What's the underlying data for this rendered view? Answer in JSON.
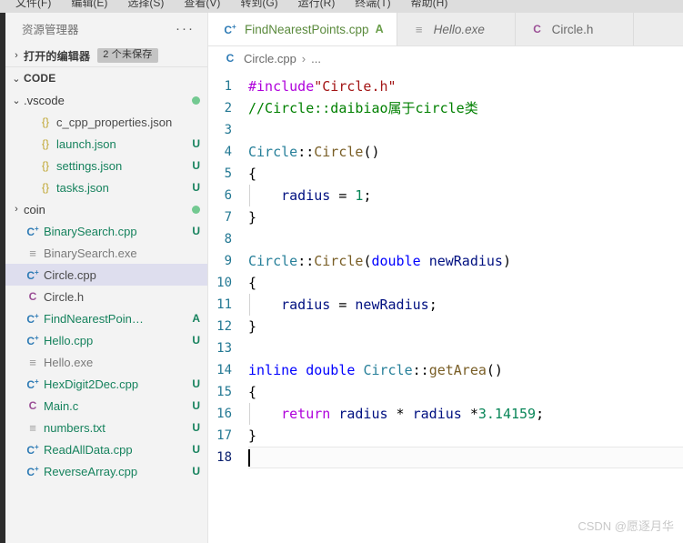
{
  "menubar": {
    "items": [
      {
        "label": "文件(F)"
      },
      {
        "label": "编辑(E)"
      },
      {
        "label": "选择(S)"
      },
      {
        "label": "查看(V)"
      },
      {
        "label": "转到(G)"
      },
      {
        "label": "运行(R)"
      },
      {
        "label": "终端(T)"
      },
      {
        "label": "帮助(H)"
      }
    ]
  },
  "sidebar": {
    "title": "资源管理器",
    "more_label": "···",
    "open_editors": {
      "twisty": "›",
      "label": "打开的编辑器",
      "badge": "2 个未保存"
    },
    "workspace": {
      "twisty": "⌄",
      "label": "CODE"
    },
    "tree": [
      {
        "icon": "chevron-down-icon",
        "icon_glyph": "⌄",
        "icon_class": "",
        "name": ".vscode",
        "kind": "folder",
        "indent": 1,
        "status": "",
        "dot": true
      },
      {
        "icon": "json-file-icon",
        "icon_glyph": "{}",
        "icon_class": "json",
        "name": "c_cpp_properties.json",
        "kind": "file-plain",
        "indent": 2,
        "status": "",
        "dot": false
      },
      {
        "icon": "json-file-icon",
        "icon_glyph": "{}",
        "icon_class": "json",
        "name": "launch.json",
        "kind": "file-mod",
        "indent": 2,
        "status": "U",
        "dot": false
      },
      {
        "icon": "json-file-icon",
        "icon_glyph": "{}",
        "icon_class": "json",
        "name": "settings.json",
        "kind": "file-mod",
        "indent": 2,
        "status": "U",
        "dot": false
      },
      {
        "icon": "json-file-icon",
        "icon_glyph": "{}",
        "icon_class": "json",
        "name": "tasks.json",
        "kind": "file-mod",
        "indent": 2,
        "status": "U",
        "dot": false
      },
      {
        "icon": "chevron-right-icon",
        "icon_glyph": "›",
        "icon_class": "",
        "name": "coin",
        "kind": "folder",
        "indent": 1,
        "status": "",
        "dot": true
      },
      {
        "icon": "cpp-file-icon",
        "icon_glyph": "C",
        "icon_class": "cpp",
        "name": "BinarySearch.cpp",
        "kind": "file-mod",
        "indent": 1,
        "status": "U",
        "dot": false
      },
      {
        "icon": "binary-file-icon",
        "icon_glyph": "≡",
        "icon_class": "txt",
        "name": "BinarySearch.exe",
        "kind": "file-plain",
        "indent": 1,
        "status": "",
        "dot": false
      },
      {
        "icon": "cpp-file-icon",
        "icon_glyph": "C",
        "icon_class": "cpp",
        "name": "Circle.cpp",
        "kind": "file-plain",
        "indent": 1,
        "status": "",
        "dot": false,
        "selected": true
      },
      {
        "icon": "header-file-icon",
        "icon_glyph": "C",
        "icon_class": "hdr",
        "name": "Circle.h",
        "kind": "file-plain",
        "indent": 1,
        "status": "",
        "dot": false
      },
      {
        "icon": "cpp-file-icon",
        "icon_glyph": "C",
        "icon_class": "cpp",
        "name": "FindNearestPoin…",
        "kind": "file-mod",
        "indent": 1,
        "status": "A",
        "dot": false
      },
      {
        "icon": "cpp-file-icon",
        "icon_glyph": "C",
        "icon_class": "cpp",
        "name": "Hello.cpp",
        "kind": "file-mod",
        "indent": 1,
        "status": "U",
        "dot": false
      },
      {
        "icon": "binary-file-icon",
        "icon_glyph": "≡",
        "icon_class": "txt",
        "name": "Hello.exe",
        "kind": "file-plain",
        "indent": 1,
        "status": "",
        "dot": false
      },
      {
        "icon": "cpp-file-icon",
        "icon_glyph": "C",
        "icon_class": "cpp",
        "name": "HexDigit2Dec.cpp",
        "kind": "file-mod",
        "indent": 1,
        "status": "U",
        "dot": false
      },
      {
        "icon": "c-file-icon",
        "icon_glyph": "C",
        "icon_class": "hdr",
        "name": "Main.c",
        "kind": "file-mod",
        "indent": 1,
        "status": "U",
        "dot": false
      },
      {
        "icon": "text-file-icon",
        "icon_glyph": "≡",
        "icon_class": "txt",
        "name": "numbers.txt",
        "kind": "file-mod",
        "indent": 1,
        "status": "U",
        "dot": false
      },
      {
        "icon": "cpp-file-icon",
        "icon_glyph": "C",
        "icon_class": "cpp",
        "name": "ReadAllData.cpp",
        "kind": "file-mod",
        "indent": 1,
        "status": "U",
        "dot": false
      },
      {
        "icon": "cpp-file-icon",
        "icon_glyph": "C",
        "icon_class": "cpp",
        "name": "ReverseArray.cpp",
        "kind": "file-mod",
        "indent": 1,
        "status": "U",
        "dot": false
      }
    ]
  },
  "editor": {
    "tabs": [
      {
        "icon": "cpp-file-icon",
        "icon_glyph": "C",
        "icon_class": "cpp",
        "label": "FindNearestPoints.cpp",
        "status": "A",
        "active": true,
        "italic": false,
        "green": true
      },
      {
        "icon": "binary-file-icon",
        "icon_glyph": "≡",
        "icon_class": "txt",
        "label": "Hello.exe",
        "status": "",
        "active": false,
        "italic": true,
        "green": false
      },
      {
        "icon": "header-file-icon",
        "icon_glyph": "C",
        "icon_class": "hdr",
        "label": "Circle.h",
        "status": "",
        "active": false,
        "italic": false,
        "green": false
      }
    ],
    "breadcrumb": {
      "icon": "cpp-file-icon",
      "icon_glyph": "C",
      "file": "Circle.cpp",
      "separator": "›",
      "tail": "..."
    },
    "code": {
      "lines": [
        {
          "n": "1",
          "tokens": [
            {
              "t": "#include",
              "c": "t-pre"
            },
            {
              "t": "\"Circle.h\"",
              "c": "t-str"
            }
          ],
          "indent_guide": false
        },
        {
          "n": "2",
          "tokens": [
            {
              "t": "//Circle::daibiao属于circle类",
              "c": "t-com"
            }
          ],
          "indent_guide": false
        },
        {
          "n": "3",
          "tokens": [],
          "indent_guide": false
        },
        {
          "n": "4",
          "tokens": [
            {
              "t": "Circle",
              "c": "t-type"
            },
            {
              "t": "::",
              "c": "t-plain"
            },
            {
              "t": "Circle",
              "c": "t-fn"
            },
            {
              "t": "()",
              "c": "t-plain"
            }
          ],
          "indent_guide": false
        },
        {
          "n": "5",
          "tokens": [
            {
              "t": "{",
              "c": "t-plain"
            }
          ],
          "indent_guide": false
        },
        {
          "n": "6",
          "tokens": [
            {
              "t": "    ",
              "c": "t-plain"
            },
            {
              "t": "radius",
              "c": "t-var"
            },
            {
              "t": " = ",
              "c": "t-plain"
            },
            {
              "t": "1",
              "c": "t-num"
            },
            {
              "t": ";",
              "c": "t-plain"
            }
          ],
          "indent_guide": true
        },
        {
          "n": "7",
          "tokens": [
            {
              "t": "}",
              "c": "t-plain"
            }
          ],
          "indent_guide": false
        },
        {
          "n": "8",
          "tokens": [],
          "indent_guide": false
        },
        {
          "n": "9",
          "tokens": [
            {
              "t": "Circle",
              "c": "t-type"
            },
            {
              "t": "::",
              "c": "t-plain"
            },
            {
              "t": "Circle",
              "c": "t-fn"
            },
            {
              "t": "(",
              "c": "t-plain"
            },
            {
              "t": "double",
              "c": "t-kw"
            },
            {
              "t": " ",
              "c": "t-plain"
            },
            {
              "t": "newRadius",
              "c": "t-var"
            },
            {
              "t": ")",
              "c": "t-plain"
            }
          ],
          "indent_guide": false
        },
        {
          "n": "10",
          "tokens": [
            {
              "t": "{",
              "c": "t-plain"
            }
          ],
          "indent_guide": false
        },
        {
          "n": "11",
          "tokens": [
            {
              "t": "    ",
              "c": "t-plain"
            },
            {
              "t": "radius",
              "c": "t-var"
            },
            {
              "t": " = ",
              "c": "t-plain"
            },
            {
              "t": "newRadius",
              "c": "t-var"
            },
            {
              "t": ";",
              "c": "t-plain"
            }
          ],
          "indent_guide": true
        },
        {
          "n": "12",
          "tokens": [
            {
              "t": "}",
              "c": "t-plain"
            }
          ],
          "indent_guide": false
        },
        {
          "n": "13",
          "tokens": [],
          "indent_guide": false
        },
        {
          "n": "14",
          "tokens": [
            {
              "t": "inline",
              "c": "t-kw"
            },
            {
              "t": " ",
              "c": "t-plain"
            },
            {
              "t": "double",
              "c": "t-kw"
            },
            {
              "t": " ",
              "c": "t-plain"
            },
            {
              "t": "Circle",
              "c": "t-type"
            },
            {
              "t": "::",
              "c": "t-plain"
            },
            {
              "t": "getArea",
              "c": "t-fn"
            },
            {
              "t": "()",
              "c": "t-plain"
            }
          ],
          "indent_guide": false
        },
        {
          "n": "15",
          "tokens": [
            {
              "t": "{",
              "c": "t-plain"
            }
          ],
          "indent_guide": false
        },
        {
          "n": "16",
          "tokens": [
            {
              "t": "    ",
              "c": "t-plain"
            },
            {
              "t": "return",
              "c": "t-pre"
            },
            {
              "t": " ",
              "c": "t-plain"
            },
            {
              "t": "radius",
              "c": "t-var"
            },
            {
              "t": " * ",
              "c": "t-plain"
            },
            {
              "t": "radius",
              "c": "t-var"
            },
            {
              "t": " *",
              "c": "t-plain"
            },
            {
              "t": "3.14159",
              "c": "t-num"
            },
            {
              "t": ";",
              "c": "t-plain"
            }
          ],
          "indent_guide": true
        },
        {
          "n": "17",
          "tokens": [
            {
              "t": "}",
              "c": "t-plain"
            }
          ],
          "indent_guide": false
        },
        {
          "n": "18",
          "tokens": [],
          "indent_guide": false,
          "active": true,
          "cursor": true
        }
      ]
    }
  },
  "watermark": "CSDN @愿逐月华"
}
